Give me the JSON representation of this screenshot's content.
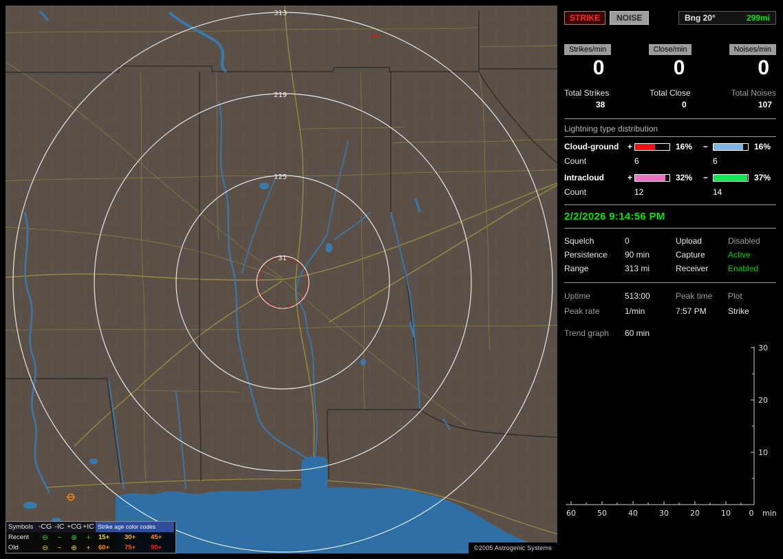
{
  "header": {
    "strike": "STRIKE",
    "noise": "NOISE",
    "bearing": "Bng 20°",
    "range": "299mi"
  },
  "counters": {
    "items": [
      {
        "label": "Strikes/min",
        "value": "0"
      },
      {
        "label": "Close/min",
        "value": "0"
      },
      {
        "label": "Noises/min",
        "value": "0"
      }
    ]
  },
  "totals": {
    "items": [
      {
        "label": "Total Strikes",
        "value": "38",
        "label_color": "#e6e6e6"
      },
      {
        "label": "Total Close",
        "value": "0",
        "label_color": "#e6e6e6"
      },
      {
        "label": "Total Noises",
        "value": "107",
        "label_color": "#9c9c9c"
      }
    ]
  },
  "distribution": {
    "title": "Lightning type distribution",
    "count_label": "Count",
    "plus": "+",
    "minus": "−",
    "rows": [
      {
        "label": "Cloud-ground",
        "pos_pct": "16%",
        "pos_fill": "58%",
        "pos_color": "#ee1111",
        "pos_count": "6",
        "neg_pct": "16%",
        "neg_fill": "85%",
        "neg_color": "#7fb2e5",
        "neg_count": "6"
      },
      {
        "label": "Intracloud",
        "pos_pct": "32%",
        "pos_fill": "88%",
        "pos_color": "#ef6fc2",
        "pos_count": "12",
        "neg_pct": "37%",
        "neg_fill": "97%",
        "neg_color": "#18e14f",
        "neg_count": "14"
      }
    ]
  },
  "clock": {
    "datetime": "2/2/2026 9:14:56 PM",
    "color": "#00e400"
  },
  "status": {
    "rows": [
      {
        "l1": "Squelch",
        "v1": "0",
        "l2": "Upload",
        "v2": "Disabled",
        "v2_color": "#9c9c9c"
      },
      {
        "l1": "Persistence",
        "v1": "90 min",
        "l2": "Capture",
        "v2": "Active",
        "v2_color": "#00d400"
      },
      {
        "l1": "Range",
        "v1": "313 mi",
        "l2": "Receiver",
        "v2": "Enabled",
        "v2_color": "#00d400"
      }
    ]
  },
  "session": {
    "uptime_label": "Uptime",
    "uptime_value": "513:00",
    "peak_time_label": "Peak time",
    "plot_label": "Plot",
    "peak_rate_label": "Peak rate",
    "peak_rate_value": "1/min",
    "peak_time_value": "7:57 PM",
    "plot_value": "Strike",
    "trend_label": "Trend graph",
    "trend_value": "60 min"
  },
  "chart_data": {
    "type": "line",
    "title": "Trend graph",
    "window_minutes": 60,
    "x_ticks": [
      "60",
      "50",
      "40",
      "30",
      "20",
      "10",
      "0"
    ],
    "x_unit": "min",
    "y_ticks": [
      "30",
      "20",
      "10"
    ],
    "ylim": [
      0,
      30
    ],
    "xlim_minutes_ago": [
      60,
      0
    ],
    "legend_position": "none",
    "series": [
      {
        "name": "Strike",
        "values": []
      }
    ],
    "note": "trend plot empty - no strikes in current window"
  },
  "map": {
    "range_labels": [
      "313",
      "219",
      "125",
      "31"
    ],
    "copyright": "©2005 Astrogenic Systems",
    "legend": {
      "symbols_header": "Symbols",
      "symbol_cols": [
        "-CG",
        "-IC",
        "+CG",
        "+IC"
      ],
      "age_header": "Strike age color codes",
      "rows": [
        {
          "label": "Recent",
          "glyphs": [
            "⊖",
            "−",
            "⊕",
            "+"
          ],
          "glyph_color": "#21d421",
          "ages": [
            {
              "t": "15+",
              "c": "#e8e400"
            },
            {
              "t": "30+",
              "c": "#ffb400"
            },
            {
              "t": "45+",
              "c": "#ff8c00"
            }
          ]
        },
        {
          "label": "Old",
          "glyphs": [
            "⊖",
            "−",
            "⊕",
            "+"
          ],
          "glyph_color": "#d8d400",
          "ages": [
            {
              "t": "60+",
              "c": "#ff8c00"
            },
            {
              "t": "75+",
              "c": "#ff5a00"
            },
            {
              "t": "90+",
              "c": "#ff1e00"
            }
          ]
        }
      ]
    }
  }
}
